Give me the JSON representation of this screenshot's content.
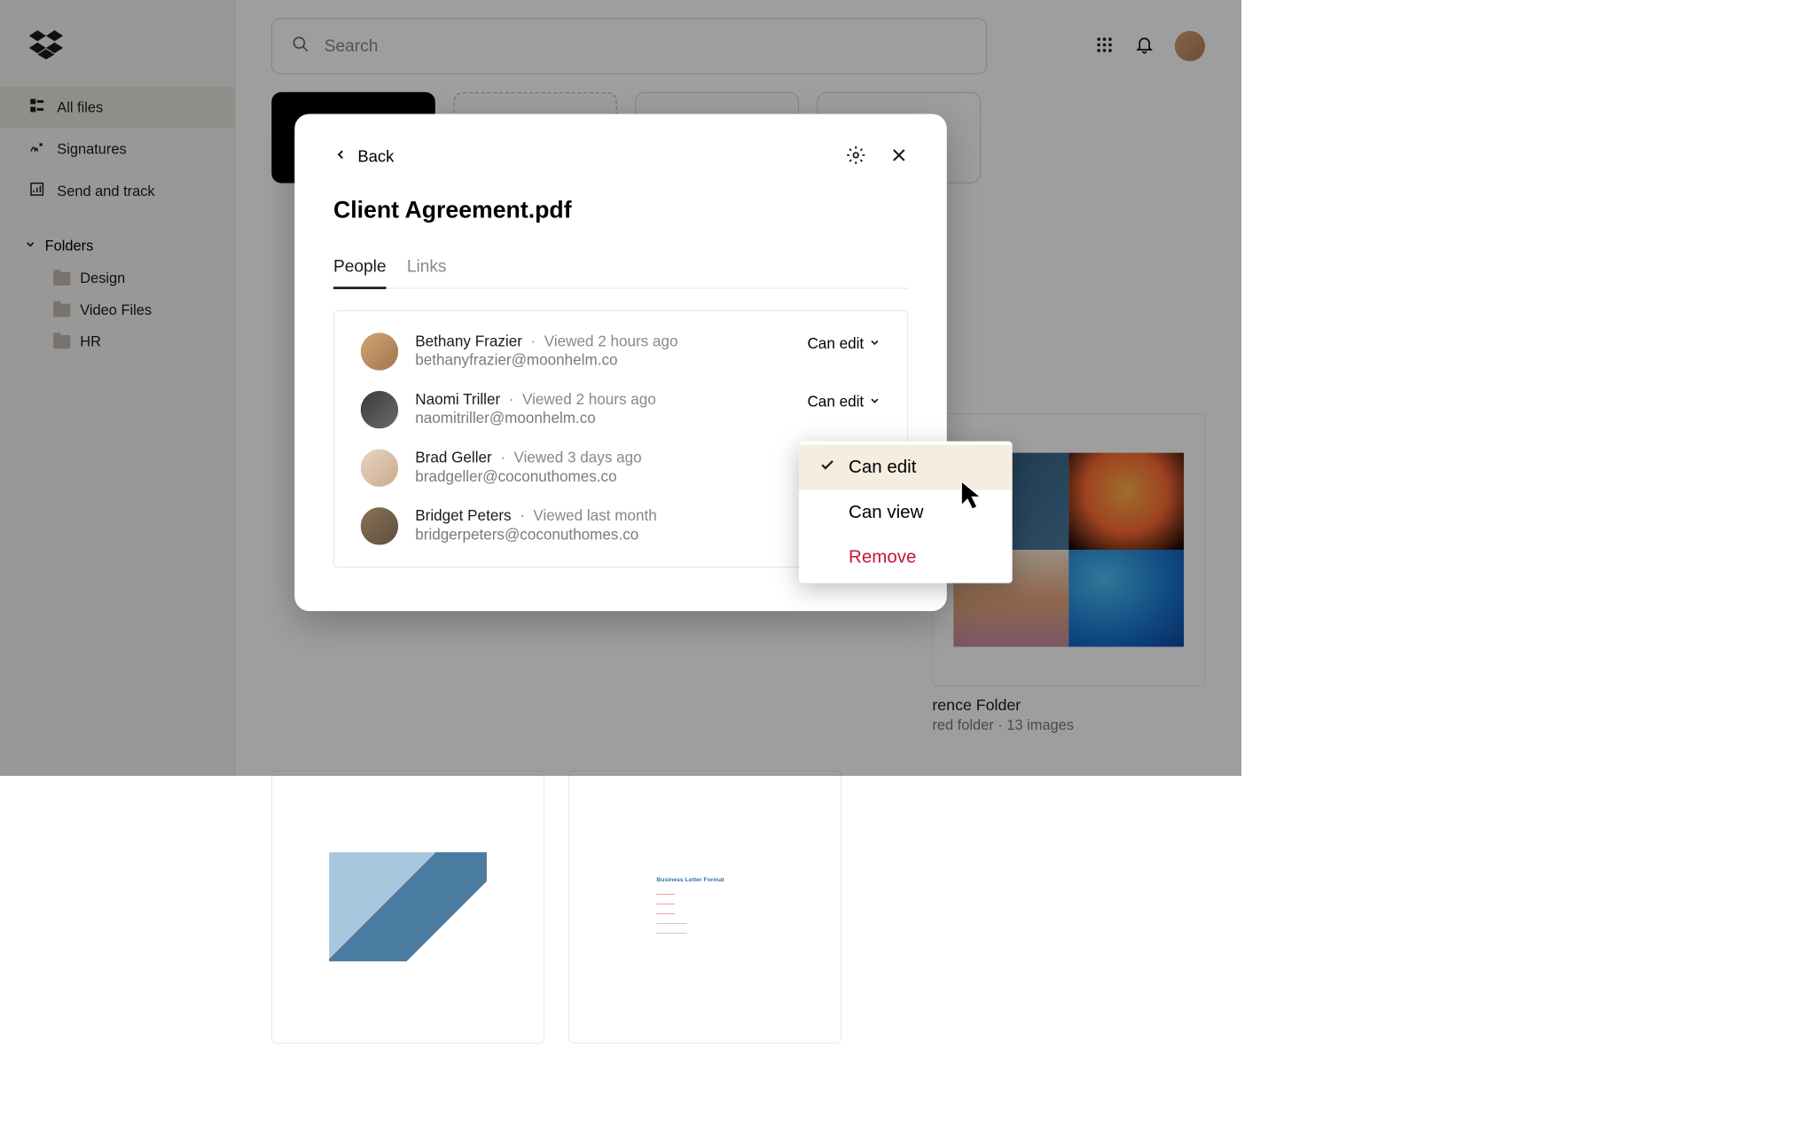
{
  "header": {
    "search_placeholder": "Search"
  },
  "sidebar": {
    "items": [
      {
        "label": "All files"
      },
      {
        "label": "Signatures"
      },
      {
        "label": "Send and track"
      }
    ],
    "folders_label": "Folders",
    "folders": [
      {
        "label": "Design"
      },
      {
        "label": "Video Files"
      },
      {
        "label": "HR"
      }
    ]
  },
  "content": {
    "folder_card": {
      "title_suffix": "rence Folder",
      "meta_visible": "red folder · 13 images"
    }
  },
  "modal": {
    "back_label": "Back",
    "title": "Client Agreement.pdf",
    "tabs": [
      {
        "label": "People"
      },
      {
        "label": "Links"
      }
    ],
    "people": [
      {
        "name": "Bethany Frazier",
        "viewed": "Viewed 2 hours ago",
        "email": "bethanyfrazier@moonhelm.co",
        "perm": "Can edit"
      },
      {
        "name": "Naomi Triller",
        "viewed": "Viewed 2 hours ago",
        "email": "naomitriller@moonhelm.co",
        "perm": "Can edit"
      },
      {
        "name": "Brad Geller",
        "viewed": "Viewed 3 days ago",
        "email": "bradgeller@coconuthomes.co",
        "perm": ""
      },
      {
        "name": "Bridget Peters",
        "viewed": "Viewed last month",
        "email": "bridgerpeters@coconuthomes.co",
        "perm": ""
      }
    ]
  },
  "dropdown": {
    "items": [
      {
        "label": "Can edit"
      },
      {
        "label": "Can view"
      },
      {
        "label": "Remove"
      }
    ]
  }
}
